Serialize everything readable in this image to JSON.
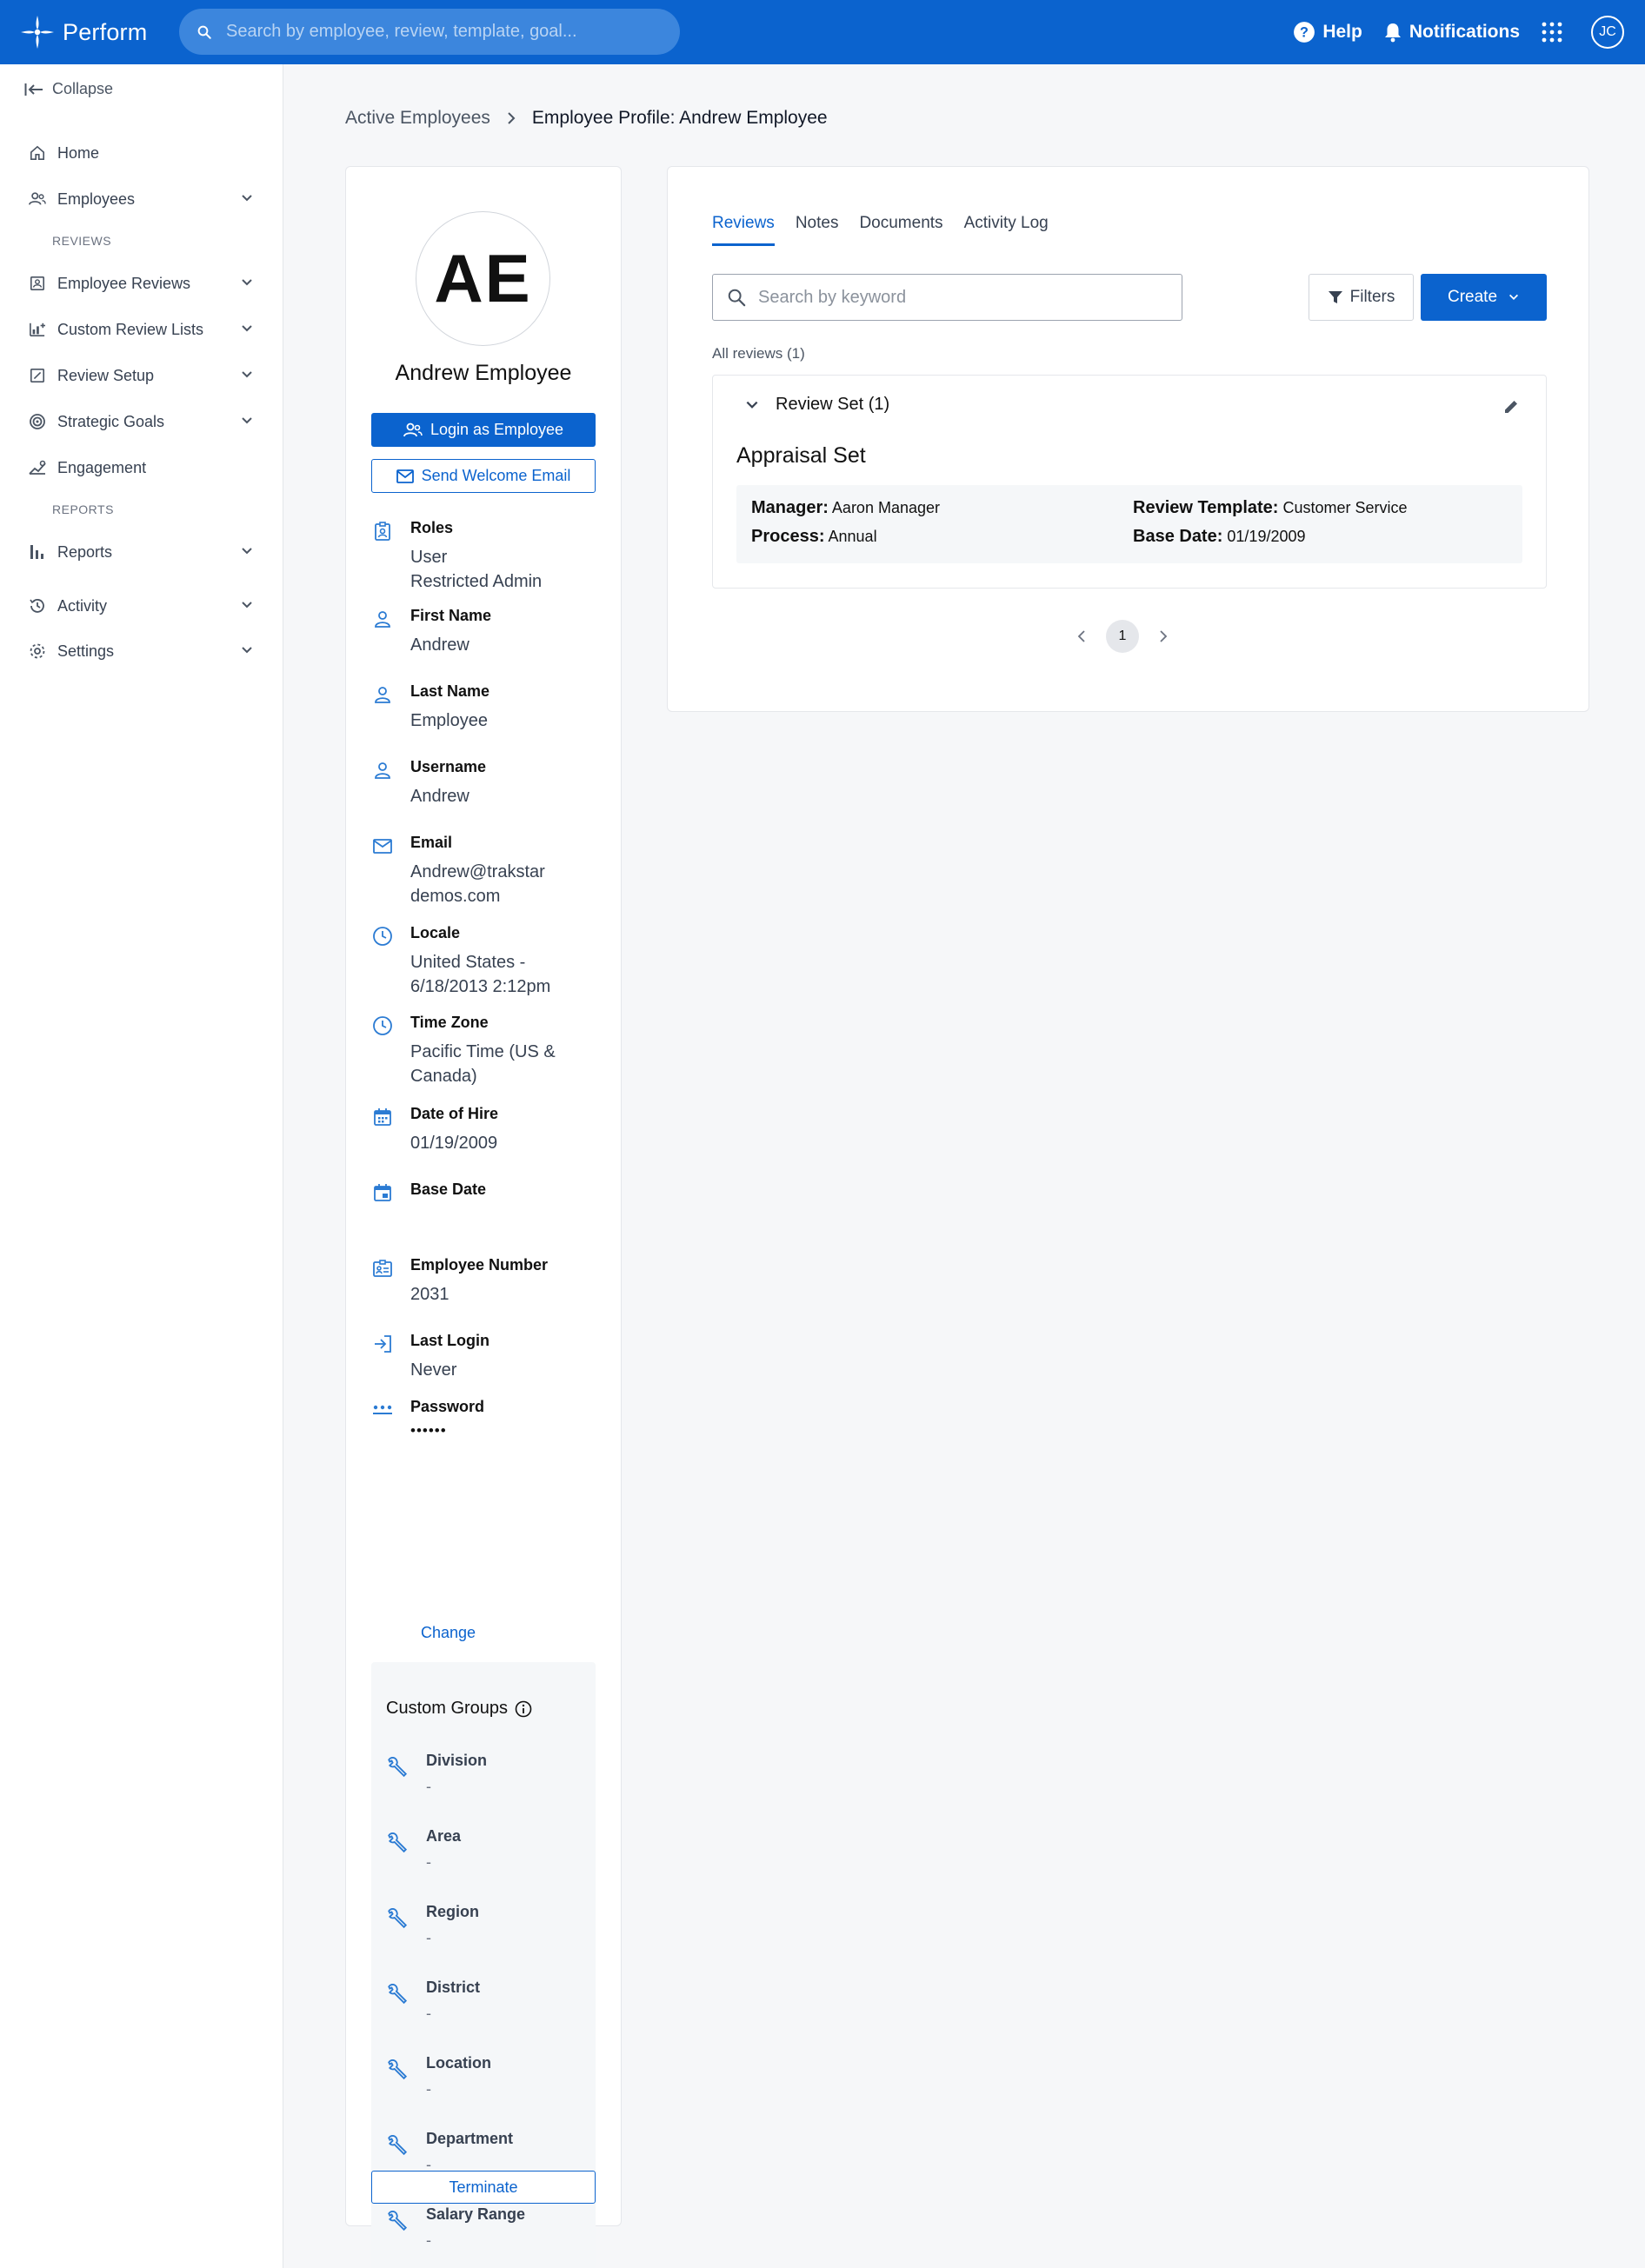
{
  "brand": {
    "name": "Perform"
  },
  "global_search": {
    "placeholder": "Search by employee, review, template, goal..."
  },
  "topbar": {
    "help": "Help",
    "notifications": "Notifications",
    "user_initials": "JC"
  },
  "sidebar": {
    "collapse": "Collapse",
    "items": {
      "home": "Home",
      "employees": "Employees",
      "section_reviews": "REVIEWS",
      "employee_reviews": "Employee Reviews",
      "custom_review_lists": "Custom Review Lists",
      "review_setup": "Review Setup",
      "strategic_goals": "Strategic Goals",
      "engagement": "Engagement",
      "section_reports": "REPORTS",
      "reports": "Reports",
      "activity": "Activity",
      "settings": "Settings"
    }
  },
  "breadcrumb": {
    "parent": "Active Employees",
    "current": "Employee Profile: Andrew Employee"
  },
  "profile": {
    "initials": "AE",
    "name": "Andrew Employee",
    "login_as": "Login as Employee",
    "send_welcome": "Send Welcome Email",
    "fields": {
      "roles": {
        "label": "Roles",
        "value": "User\nRestricted Admin"
      },
      "first_name": {
        "label": "First Name",
        "value": "Andrew"
      },
      "last_name": {
        "label": "Last Name",
        "value": "Employee"
      },
      "username": {
        "label": "Username",
        "value": "Andrew"
      },
      "email": {
        "label": "Email",
        "value": "Andrew@trakstardemos.com"
      },
      "locale": {
        "label": "Locale",
        "value": "United States - 6/18/2013 2:12pm"
      },
      "time_zone": {
        "label": "Time Zone",
        "value": "Pacific Time (US & Canada)"
      },
      "date_of_hire": {
        "label": "Date of Hire",
        "value": "01/19/2009"
      },
      "base_date": {
        "label": "Base Date",
        "value": ""
      },
      "employee_number": {
        "label": "Employee Number",
        "value": "2031"
      },
      "last_login": {
        "label": "Last Login",
        "value": "Never"
      },
      "password": {
        "label": "Password",
        "value": "••••••"
      }
    },
    "change": "Change",
    "custom_groups": {
      "title": "Custom Groups",
      "items": [
        {
          "label": "Division",
          "value": "-"
        },
        {
          "label": "Area",
          "value": "-"
        },
        {
          "label": "Region",
          "value": "-"
        },
        {
          "label": "District",
          "value": "-"
        },
        {
          "label": "Location",
          "value": "-"
        },
        {
          "label": "Department",
          "value": "-"
        },
        {
          "label": "Salary Range",
          "value": "-"
        }
      ]
    },
    "terminate": "Terminate"
  },
  "reviews": {
    "tabs": [
      "Reviews",
      "Notes",
      "Documents",
      "Activity Log"
    ],
    "active_tab": "Reviews",
    "search_placeholder": "Search by keyword",
    "filters": "Filters",
    "create": "Create",
    "all_reviews": "All reviews (1)",
    "review_set": {
      "header": "Review Set (1)",
      "title": "Appraisal Set",
      "manager_label": "Manager:",
      "manager": "Aaron Manager",
      "process_label": "Process:",
      "process": "Annual",
      "template_label": "Review Template:",
      "template": "Customer Service",
      "base_date_label": "Base Date:",
      "base_date": "01/19/2009"
    },
    "page": "1"
  },
  "colors": {
    "primary": "#0b63ce",
    "icon_blue": "#2b7bd3"
  }
}
